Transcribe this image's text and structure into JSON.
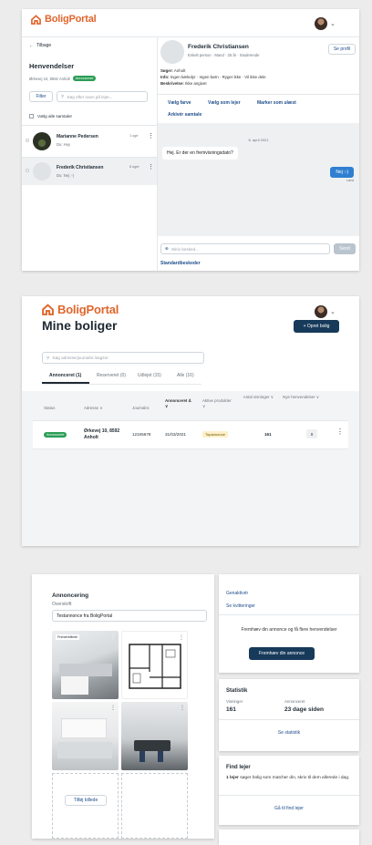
{
  "brand": {
    "name": "BoligPortal",
    "color": "#e0662d"
  },
  "messages": {
    "back": "Tilbage",
    "title": "Henvendelser",
    "address": "Ørkevej 10, 8592 Anholt",
    "status_badge": "Annonceret",
    "filter_label": "Filter",
    "search_placeholder": "Søg efter navn på lejer...",
    "select_all": "Vælg alle samtaler",
    "conversations": [
      {
        "name": "Marianne Pedersen",
        "preview": "Du: Hey",
        "time": "1 uge"
      },
      {
        "name": "Frederik Christiansen",
        "preview": "Du: Nej :-)",
        "time": "6 uger"
      }
    ],
    "profile": {
      "name": "Frederik Christiansen",
      "sub": "Enkelt person · Mand · 25 år · Studerende",
      "seeks_label": "Søger:",
      "seeks": "Anholt",
      "info_label": "Info:",
      "info": "Ingen kæledyr · Ingen børn · Ryger ikke · Vil ikke dele",
      "desc_label": "Beskrivelse:",
      "desc": "Ikke angivet",
      "see_profile": "Se profil"
    },
    "actions": [
      "Vælg farve",
      "Vælg som lejer",
      "Marker som ulæst",
      "Arkivér samtale"
    ],
    "date": "6. april 2021",
    "incoming": "Hej. Er der en fremvisningsdato?",
    "outgoing": "Nej :-)",
    "read": "Læst",
    "compose_placeholder": "Skriv besked...",
    "send": "Send",
    "standard": "Standardbeskeder"
  },
  "listings": {
    "title": "Mine boliger",
    "create_button": "+ Opret bolig",
    "search_placeholder": "Søg adresse/journalnr./sagsnr.",
    "tabs": [
      "Annonceret (1)",
      "Reserveret (0)",
      "Udlejet (15)",
      "Alle (16)"
    ],
    "columns": [
      "Status",
      "Adresse ∨",
      "Journalnr.",
      "Annonceret d. ∨",
      "Aktive produkter ∨",
      "Antal visninger ∨",
      "Nye henvendelser ∨"
    ],
    "row": {
      "status": "Annonceret",
      "address": "Ørkevej 10, 8592 Anholt",
      "journal": "12345678",
      "date": "31/03/2021",
      "product": "Topannonce",
      "views": "161",
      "new": "0"
    }
  },
  "ad": {
    "title": "Annoncering",
    "headline_label": "Overskrift",
    "headline_value": "Testannonce fra BoligPortal",
    "primary_tag": "Primærbillede",
    "add_image": "Tilføj billede",
    "links": [
      "Genaktivér",
      "Se kvitteringer"
    ],
    "promo_text": "Fremhæv din annonce og få flere henvendelser",
    "promo_button": "Fremhæv din annonce",
    "stats_title": "Statistik",
    "views_label": "Visninger",
    "views_value": "161",
    "ads_label": "Annonceret",
    "ads_value": "23 dage siden",
    "stats_link": "Se statistik",
    "find_title": "Find lejer",
    "find_text_bold": "1 lejer",
    "find_text": "søger bolig som matcher din, skriv til dem allerede i dag.",
    "find_link": "Gå til find lejer"
  }
}
